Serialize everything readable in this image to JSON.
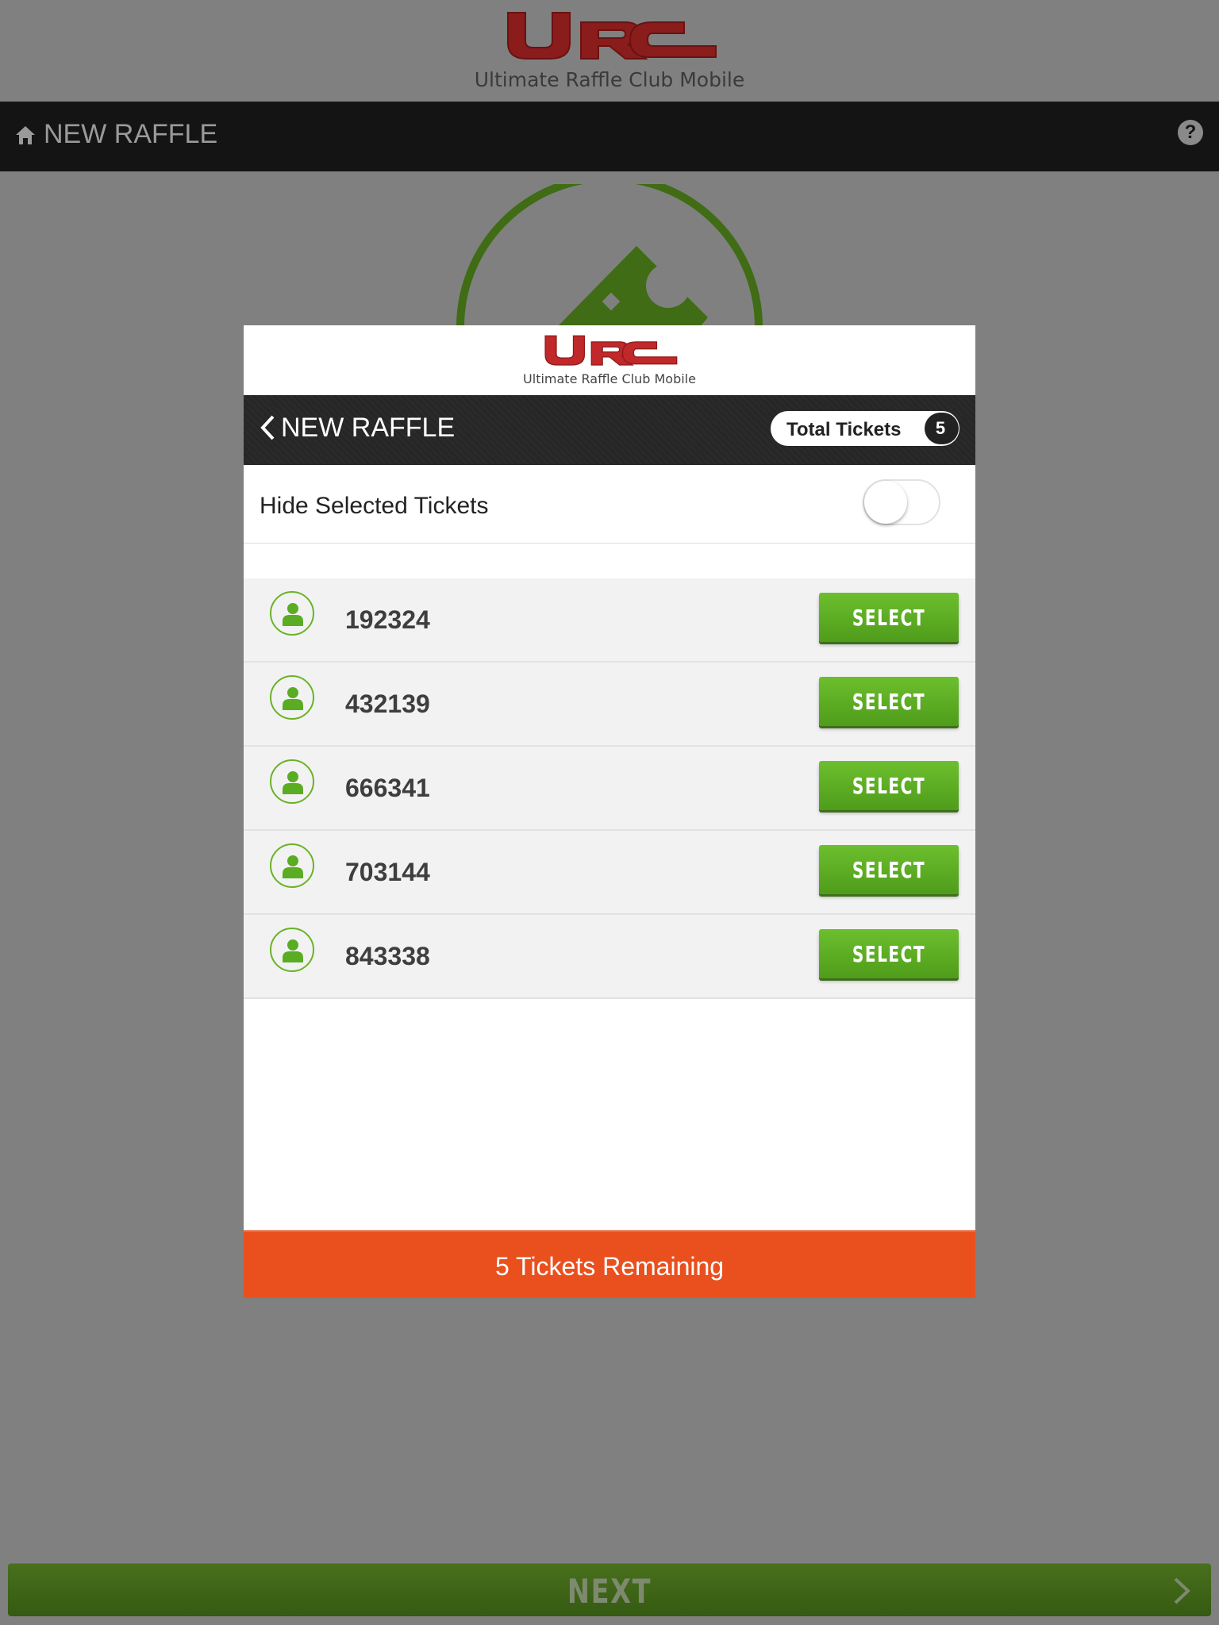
{
  "app": {
    "logo_text": "URC",
    "tagline": "Ultimate Raffle Club Mobile"
  },
  "background": {
    "nav_title": "NEW RAFFLE",
    "help_label": "?",
    "next_label": "NEXT"
  },
  "modal": {
    "nav_title": "NEW RAFFLE",
    "total_tickets_label": "Total Tickets",
    "total_tickets_count": "5",
    "hide_selected_label": "Hide Selected Tickets",
    "hide_selected_on": false,
    "tickets": [
      {
        "number": "192324",
        "button": "SELECT"
      },
      {
        "number": "432139",
        "button": "SELECT"
      },
      {
        "number": "666341",
        "button": "SELECT"
      },
      {
        "number": "703144",
        "button": "SELECT"
      },
      {
        "number": "843338",
        "button": "SELECT"
      }
    ],
    "remaining_label": "5 Tickets Remaining"
  },
  "colors": {
    "accent_green": "#5aad22",
    "remaining_orange": "#e9501e",
    "logo_red": "#c0282a",
    "overlay_gray": "#808080"
  },
  "icons": [
    "home-icon",
    "help-icon",
    "ticket-icon",
    "chevron-left-icon",
    "user-icon",
    "chevron-right-icon"
  ]
}
